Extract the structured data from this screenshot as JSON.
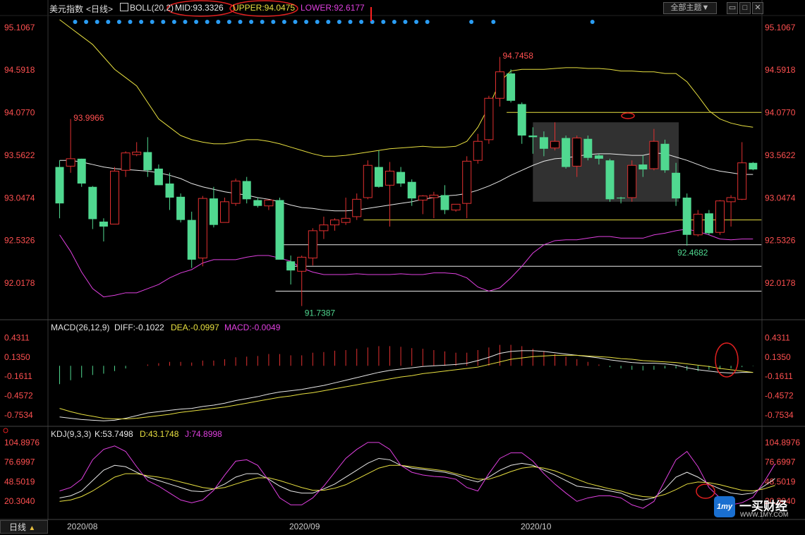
{
  "instrument": {
    "name": "美元指数",
    "period": "日线",
    "indicator_icon": "chart-icon"
  },
  "top_buttons": {
    "theme": "全部主题",
    "theme_arrow": "▼",
    "icons": [
      "window-restore-icon",
      "window-maximize-icon",
      "close-icon"
    ]
  },
  "boll": {
    "label": "BOLL(20,2)",
    "mid": "MID:93.3326",
    "upper": "UPPER:94.0475",
    "lower": "LOWER:92.6177"
  },
  "macd": {
    "label": "MACD(26,12,9)",
    "diff": "DIFF:-0.1022",
    "dea": "DEA:-0.0997",
    "macd": "MACD:-0.0049"
  },
  "kdj": {
    "label": "KDJ(9,3,3)",
    "k": "K:53.7498",
    "d": "D:43.1748",
    "j": "J:74.8998"
  },
  "period_button": {
    "label": "日线",
    "arrow": "▲"
  },
  "dates": [
    "2020/08",
    "2020/09",
    "2020/10"
  ],
  "watermark": {
    "logo_text": "1my",
    "title": "一买财经",
    "url": "WWW.1MY.COM"
  },
  "colors": {
    "up": "#e03030",
    "down": "#50d890",
    "mid": "#e8e8e8",
    "upper": "#e8e040",
    "lower": "#e040e0",
    "price_axis": "#ff5050",
    "macd_axis": "#ff5050",
    "kdj_axis": "#ff5050",
    "label_up": "#ff5050",
    "label_down": "#50d890"
  },
  "chart_data": [
    {
      "type": "candlestick",
      "title": "美元指数 日线",
      "y_ticks": [
        "95.1067",
        "94.5918",
        "94.0770",
        "93.5622",
        "93.0474",
        "92.5326",
        "92.0178"
      ],
      "ylim": [
        91.6,
        95.25
      ],
      "annotations": [
        {
          "text": "93.9966",
          "value": 93.9966,
          "index": 1
        },
        {
          "text": "94.7458",
          "value": 94.7458,
          "index": 40
        },
        {
          "text": "91.7387",
          "value": 91.7387,
          "index": 22
        },
        {
          "text": "92.4682",
          "value": 92.4682,
          "index": 56
        }
      ],
      "candles": [
        {
          "o": 93.42,
          "h": 93.5,
          "l": 92.8,
          "c": 92.98
        },
        {
          "o": 93.43,
          "h": 94.0,
          "l": 93.35,
          "c": 93.52
        },
        {
          "o": 93.52,
          "h": 93.52,
          "l": 93.18,
          "c": 93.22
        },
        {
          "o": 93.18,
          "h": 93.19,
          "l": 92.67,
          "c": 92.79
        },
        {
          "o": 92.76,
          "h": 92.8,
          "l": 92.52,
          "c": 92.7
        },
        {
          "o": 92.73,
          "h": 93.42,
          "l": 92.73,
          "c": 93.37
        },
        {
          "o": 93.38,
          "h": 93.61,
          "l": 93.3,
          "c": 93.59
        },
        {
          "o": 93.57,
          "h": 93.72,
          "l": 93.55,
          "c": 93.6
        },
        {
          "o": 93.6,
          "h": 93.78,
          "l": 93.3,
          "c": 93.38
        },
        {
          "o": 93.4,
          "h": 93.45,
          "l": 93.2,
          "c": 93.2
        },
        {
          "o": 93.22,
          "h": 93.35,
          "l": 92.9,
          "c": 93.05
        },
        {
          "o": 93.06,
          "h": 93.1,
          "l": 92.75,
          "c": 92.78
        },
        {
          "o": 92.78,
          "h": 92.88,
          "l": 92.2,
          "c": 92.3
        },
        {
          "o": 92.32,
          "h": 93.07,
          "l": 92.22,
          "c": 93.04
        },
        {
          "o": 93.04,
          "h": 93.18,
          "l": 92.69,
          "c": 92.72
        },
        {
          "o": 92.75,
          "h": 93.05,
          "l": 92.75,
          "c": 93.0
        },
        {
          "o": 92.98,
          "h": 93.28,
          "l": 92.95,
          "c": 93.25
        },
        {
          "o": 93.25,
          "h": 93.3,
          "l": 92.98,
          "c": 93.03
        },
        {
          "o": 93.02,
          "h": 93.05,
          "l": 92.93,
          "c": 92.95
        },
        {
          "o": 92.95,
          "h": 93.0,
          "l": 92.9,
          "c": 93.02
        },
        {
          "o": 93.02,
          "h": 93.05,
          "l": 92.32,
          "c": 92.3
        },
        {
          "o": 92.28,
          "h": 92.35,
          "l": 92.0,
          "c": 92.17
        },
        {
          "o": 92.16,
          "h": 92.35,
          "l": 91.74,
          "c": 92.33
        },
        {
          "o": 92.32,
          "h": 92.68,
          "l": 92.23,
          "c": 92.65
        },
        {
          "o": 92.65,
          "h": 92.82,
          "l": 92.55,
          "c": 92.72
        },
        {
          "o": 92.72,
          "h": 92.8,
          "l": 92.65,
          "c": 92.78
        },
        {
          "o": 92.75,
          "h": 93.05,
          "l": 92.72,
          "c": 92.8
        },
        {
          "o": 92.82,
          "h": 93.1,
          "l": 92.78,
          "c": 93.03
        },
        {
          "o": 93.05,
          "h": 93.5,
          "l": 93.03,
          "c": 93.44
        },
        {
          "o": 93.42,
          "h": 93.62,
          "l": 93.17,
          "c": 93.18
        },
        {
          "o": 93.2,
          "h": 93.48,
          "l": 92.7,
          "c": 93.37
        },
        {
          "o": 93.36,
          "h": 93.42,
          "l": 93.18,
          "c": 93.22
        },
        {
          "o": 93.24,
          "h": 93.27,
          "l": 92.95,
          "c": 93.04
        },
        {
          "o": 93.02,
          "h": 93.08,
          "l": 92.85,
          "c": 93.07
        },
        {
          "o": 93.05,
          "h": 93.12,
          "l": 92.8,
          "c": 93.08
        },
        {
          "o": 93.08,
          "h": 93.2,
          "l": 92.85,
          "c": 92.9
        },
        {
          "o": 92.9,
          "h": 92.96,
          "l": 92.88,
          "c": 92.97
        },
        {
          "o": 92.98,
          "h": 93.55,
          "l": 92.8,
          "c": 93.49
        },
        {
          "o": 93.5,
          "h": 93.82,
          "l": 93.46,
          "c": 93.73
        },
        {
          "o": 93.75,
          "h": 94.28,
          "l": 93.7,
          "c": 94.25
        },
        {
          "o": 94.25,
          "h": 94.75,
          "l": 94.15,
          "c": 94.57
        },
        {
          "o": 94.55,
          "h": 94.6,
          "l": 94.2,
          "c": 94.22
        },
        {
          "o": 94.18,
          "h": 94.2,
          "l": 93.7,
          "c": 93.8
        },
        {
          "o": 93.8,
          "h": 93.9,
          "l": 93.58,
          "c": 93.78
        },
        {
          "o": 93.78,
          "h": 93.85,
          "l": 93.55,
          "c": 93.64
        },
        {
          "o": 93.65,
          "h": 93.96,
          "l": 93.62,
          "c": 93.73
        },
        {
          "o": 93.77,
          "h": 93.8,
          "l": 93.4,
          "c": 93.42
        },
        {
          "o": 93.43,
          "h": 93.8,
          "l": 93.3,
          "c": 93.77
        },
        {
          "o": 93.76,
          "h": 93.8,
          "l": 93.5,
          "c": 93.53
        },
        {
          "o": 93.56,
          "h": 93.58,
          "l": 93.45,
          "c": 93.52
        },
        {
          "o": 93.5,
          "h": 93.52,
          "l": 93.0,
          "c": 93.03
        },
        {
          "o": 93.05,
          "h": 93.06,
          "l": 92.98,
          "c": 93.04
        },
        {
          "o": 93.05,
          "h": 93.5,
          "l": 93.0,
          "c": 93.44
        },
        {
          "o": 93.45,
          "h": 93.56,
          "l": 93.3,
          "c": 93.39
        },
        {
          "o": 93.4,
          "h": 93.88,
          "l": 93.38,
          "c": 93.73
        },
        {
          "o": 93.7,
          "h": 93.75,
          "l": 93.35,
          "c": 93.38
        },
        {
          "o": 93.35,
          "h": 93.47,
          "l": 92.95,
          "c": 93.04
        },
        {
          "o": 93.05,
          "h": 93.1,
          "l": 92.47,
          "c": 92.6
        },
        {
          "o": 92.6,
          "h": 92.9,
          "l": 92.58,
          "c": 92.85
        },
        {
          "o": 92.86,
          "h": 92.9,
          "l": 92.6,
          "c": 92.62
        },
        {
          "o": 92.63,
          "h": 93.02,
          "l": 92.6,
          "c": 93.01
        },
        {
          "o": 93.0,
          "h": 93.08,
          "l": 92.7,
          "c": 93.05
        },
        {
          "o": 93.03,
          "h": 93.72,
          "l": 93.02,
          "c": 93.47
        },
        {
          "o": 93.47,
          "h": 93.48,
          "l": 93.38,
          "c": 93.39
        }
      ],
      "boll_mid": [
        93.5,
        93.5,
        93.48,
        93.45,
        93.42,
        93.4,
        93.39,
        93.38,
        93.37,
        93.35,
        93.32,
        93.28,
        93.22,
        93.18,
        93.15,
        93.12,
        93.1,
        93.08,
        93.05,
        93.03,
        93.0,
        92.96,
        92.93,
        92.92,
        92.9,
        92.89,
        92.89,
        92.9,
        92.92,
        92.94,
        92.96,
        92.98,
        93.0,
        93.03,
        93.05,
        93.07,
        93.08,
        93.1,
        93.14,
        93.19,
        93.25,
        93.32,
        93.38,
        93.44,
        93.49,
        93.52,
        93.53,
        93.55,
        93.57,
        93.58,
        93.58,
        93.57,
        93.56,
        93.56,
        93.59,
        93.58,
        93.54,
        93.5,
        93.45,
        93.4,
        93.37,
        93.35,
        93.33,
        93.33
      ],
      "boll_upper": [
        95.2,
        95.1,
        95.0,
        94.9,
        94.75,
        94.6,
        94.5,
        94.4,
        94.2,
        94.0,
        93.9,
        93.8,
        93.75,
        93.72,
        93.7,
        93.7,
        93.72,
        93.75,
        93.75,
        93.73,
        93.7,
        93.66,
        93.62,
        93.58,
        93.55,
        93.55,
        93.56,
        93.58,
        93.6,
        93.62,
        93.64,
        93.65,
        93.66,
        93.67,
        93.66,
        93.66,
        93.67,
        93.73,
        93.9,
        94.15,
        94.45,
        94.58,
        94.6,
        94.6,
        94.6,
        94.61,
        94.62,
        94.62,
        94.61,
        94.61,
        94.6,
        94.58,
        94.58,
        94.57,
        94.57,
        94.55,
        94.55,
        94.45,
        94.28,
        94.1,
        94.0,
        93.95,
        93.92,
        93.9
      ],
      "boll_lower": [
        92.6,
        92.4,
        92.15,
        91.95,
        91.85,
        91.87,
        91.9,
        91.9,
        91.95,
        92.0,
        92.08,
        92.14,
        92.18,
        92.26,
        92.3,
        92.3,
        92.3,
        92.33,
        92.35,
        92.35,
        92.32,
        92.28,
        92.2,
        92.15,
        92.12,
        92.12,
        92.12,
        92.13,
        92.12,
        92.12,
        92.12,
        92.13,
        92.12,
        92.12,
        92.14,
        92.14,
        92.13,
        92.08,
        91.97,
        91.92,
        91.96,
        92.08,
        92.22,
        92.38,
        92.48,
        92.53,
        92.54,
        92.54,
        92.56,
        92.58,
        92.58,
        92.56,
        92.56,
        92.56,
        92.6,
        92.62,
        92.65,
        92.67,
        92.64,
        92.6,
        92.55,
        92.54,
        92.55,
        92.55
      ]
    },
    {
      "type": "bar",
      "title": "MACD(26,12,9)",
      "y_ticks": [
        "0.4311",
        "0.1350",
        "-0.1611",
        "-0.4572",
        "-0.7534"
      ],
      "ylim": [
        -0.88,
        0.52
      ],
      "macd": [
        -0.28,
        -0.22,
        -0.18,
        -0.14,
        -0.12,
        -0.08,
        -0.04,
        0.0,
        0.02,
        0.04,
        0.06,
        0.06,
        0.05,
        0.08,
        0.08,
        0.1,
        0.13,
        0.14,
        0.15,
        0.18,
        0.18,
        0.16,
        0.16,
        0.2,
        0.21,
        0.23,
        0.24,
        0.26,
        0.28,
        0.3,
        0.3,
        0.29,
        0.27,
        0.26,
        0.24,
        0.22,
        0.2,
        0.2,
        0.24,
        0.28,
        0.32,
        0.32,
        0.3,
        0.26,
        0.22,
        0.18,
        0.14,
        0.1,
        0.06,
        0.02,
        -0.02,
        -0.04,
        -0.06,
        -0.07,
        -0.06,
        -0.04,
        -0.04,
        -0.07,
        -0.08,
        -0.06,
        -0.05,
        -0.04,
        -0.02,
        -0.005
      ],
      "diff": [
        -0.78,
        -0.8,
        -0.82,
        -0.83,
        -0.84,
        -0.83,
        -0.8,
        -0.76,
        -0.72,
        -0.7,
        -0.68,
        -0.66,
        -0.65,
        -0.62,
        -0.6,
        -0.57,
        -0.53,
        -0.5,
        -0.47,
        -0.43,
        -0.4,
        -0.38,
        -0.36,
        -0.33,
        -0.3,
        -0.26,
        -0.22,
        -0.18,
        -0.14,
        -0.1,
        -0.07,
        -0.05,
        -0.03,
        -0.01,
        0.0,
        0.01,
        0.02,
        0.04,
        0.08,
        0.13,
        0.19,
        0.22,
        0.23,
        0.23,
        0.22,
        0.2,
        0.18,
        0.16,
        0.14,
        0.12,
        0.09,
        0.07,
        0.05,
        0.04,
        0.04,
        0.03,
        0.01,
        -0.03,
        -0.06,
        -0.08,
        -0.1,
        -0.11,
        -0.1,
        -0.1
      ],
      "dea": [
        -0.65,
        -0.7,
        -0.74,
        -0.77,
        -0.8,
        -0.81,
        -0.81,
        -0.8,
        -0.78,
        -0.76,
        -0.74,
        -0.71,
        -0.69,
        -0.67,
        -0.65,
        -0.63,
        -0.6,
        -0.57,
        -0.54,
        -0.51,
        -0.48,
        -0.46,
        -0.43,
        -0.41,
        -0.38,
        -0.35,
        -0.32,
        -0.29,
        -0.26,
        -0.23,
        -0.2,
        -0.17,
        -0.15,
        -0.12,
        -0.1,
        -0.08,
        -0.06,
        -0.04,
        -0.02,
        0.02,
        0.06,
        0.1,
        0.12,
        0.14,
        0.15,
        0.16,
        0.16,
        0.16,
        0.15,
        0.14,
        0.13,
        0.11,
        0.1,
        0.08,
        0.07,
        0.06,
        0.05,
        0.03,
        0.01,
        -0.01,
        -0.04,
        -0.06,
        -0.08,
        -0.1
      ]
    },
    {
      "type": "line",
      "title": "KDJ(9,3,3)",
      "y_ticks": [
        "104.8976",
        "76.6997",
        "48.5019",
        "20.3040"
      ],
      "ylim": [
        0,
        112
      ],
      "k": [
        25,
        28,
        35,
        50,
        65,
        72,
        70,
        62,
        55,
        50,
        45,
        40,
        35,
        34,
        38,
        45,
        55,
        60,
        60,
        52,
        42,
        35,
        32,
        32,
        38,
        45,
        55,
        65,
        75,
        82,
        80,
        72,
        68,
        66,
        64,
        62,
        58,
        52,
        48,
        55,
        65,
        72,
        75,
        72,
        65,
        58,
        50,
        42,
        40,
        38,
        35,
        32,
        25,
        22,
        25,
        38,
        55,
        62,
        55,
        45,
        38,
        32,
        30,
        32,
        42,
        53
      ],
      "d": [
        20,
        22,
        27,
        35,
        45,
        55,
        60,
        60,
        57,
        55,
        52,
        48,
        44,
        40,
        38,
        40,
        45,
        50,
        54,
        54,
        50,
        45,
        40,
        36,
        36,
        39,
        44,
        52,
        60,
        68,
        72,
        72,
        70,
        68,
        66,
        64,
        60,
        56,
        52,
        52,
        57,
        63,
        68,
        70,
        68,
        64,
        58,
        52,
        46,
        42,
        38,
        35,
        30,
        27,
        26,
        30,
        37,
        45,
        48,
        47,
        44,
        40,
        36,
        35,
        38,
        43
      ],
      "j": [
        35,
        40,
        52,
        80,
        95,
        100,
        92,
        70,
        50,
        42,
        32,
        22,
        18,
        22,
        36,
        58,
        78,
        80,
        72,
        50,
        25,
        15,
        15,
        25,
        42,
        62,
        82,
        95,
        105,
        105,
        95,
        72,
        62,
        58,
        56,
        55,
        52,
        40,
        35,
        60,
        82,
        90,
        90,
        78,
        60,
        45,
        32,
        20,
        25,
        28,
        28,
        25,
        15,
        10,
        20,
        50,
        80,
        92,
        70,
        40,
        25,
        15,
        18,
        26,
        48,
        74
      ]
    }
  ]
}
